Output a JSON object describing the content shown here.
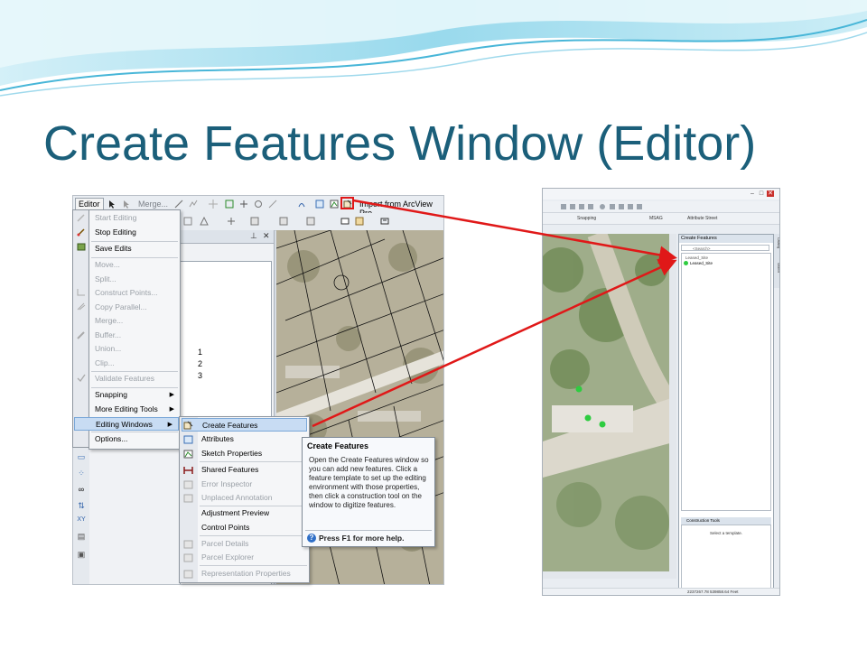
{
  "slide": {
    "title": "Create Features Window (Editor)"
  },
  "left_screenshot": {
    "toolbar": {
      "editor_label": "Editor",
      "merge_label": "Merge...",
      "import_label": "Import from ArcView Pro"
    },
    "toc_numbers": [
      "1",
      "2",
      "3"
    ],
    "editor_menu": {
      "items": [
        {
          "label": "Start Editing",
          "enabled": false
        },
        {
          "label": "Stop Editing",
          "enabled": true
        },
        {
          "label": "Save Edits",
          "enabled": true
        },
        {
          "label": "Move...",
          "enabled": false
        },
        {
          "label": "Split...",
          "enabled": false
        },
        {
          "label": "Construct Points...",
          "enabled": false
        },
        {
          "label": "Copy Parallel...",
          "enabled": false
        },
        {
          "label": "Merge...",
          "enabled": false
        },
        {
          "label": "Buffer...",
          "enabled": false
        },
        {
          "label": "Union...",
          "enabled": false
        },
        {
          "label": "Clip...",
          "enabled": false
        },
        {
          "label": "Validate Features",
          "enabled": false
        },
        {
          "label": "Snapping",
          "enabled": true,
          "submenu": true
        },
        {
          "label": "More Editing Tools",
          "enabled": true,
          "submenu": true
        },
        {
          "label": "Editing Windows",
          "enabled": true,
          "submenu": true,
          "highlighted": true
        },
        {
          "label": "Options...",
          "enabled": true
        }
      ]
    },
    "editing_windows_submenu": {
      "items": [
        {
          "label": "Create Features",
          "enabled": true,
          "highlighted": true
        },
        {
          "label": "Attributes",
          "enabled": true
        },
        {
          "label": "Sketch Properties",
          "enabled": true
        },
        {
          "label": "Shared Features",
          "enabled": true
        },
        {
          "label": "Error Inspector",
          "enabled": false
        },
        {
          "label": "Unplaced Annotation",
          "enabled": false
        },
        {
          "label": "Adjustment Preview",
          "enabled": true
        },
        {
          "label": "Control Points",
          "enabled": true
        },
        {
          "label": "Parcel Details",
          "enabled": false
        },
        {
          "label": "Parcel Explorer",
          "enabled": false
        },
        {
          "label": "Representation Properties",
          "enabled": false
        }
      ]
    },
    "tooltip": {
      "title": "Create Features",
      "body": "Open the Create Features window so you can add new features. Click a feature template to set up the editing environment with those properties, then click a construction tool on the window to digitize features.",
      "help": "Press F1 for more help."
    }
  },
  "right_screenshot": {
    "toolbar": {
      "snapping_label": "Snapping",
      "msag_label": "MSAG",
      "attribute_street_label": "Attribute Street"
    },
    "create_features_pane": {
      "title": "Create Features",
      "search_placeholder": "<Search>",
      "group_label": "Leased_Site",
      "item_label": "Leased_Site",
      "construction_tools_title": "Construction Tools",
      "construction_tools_hint": "Select a template."
    },
    "vertical_tabs": [
      "Catalog",
      "Search"
    ],
    "status_coords": "2237267.78  539858.64 Feet"
  },
  "colors": {
    "title": "#1b5f7a",
    "arrow": "#e01818",
    "highlight": "#c8dcf3",
    "feature_point": "#2ecc40"
  }
}
